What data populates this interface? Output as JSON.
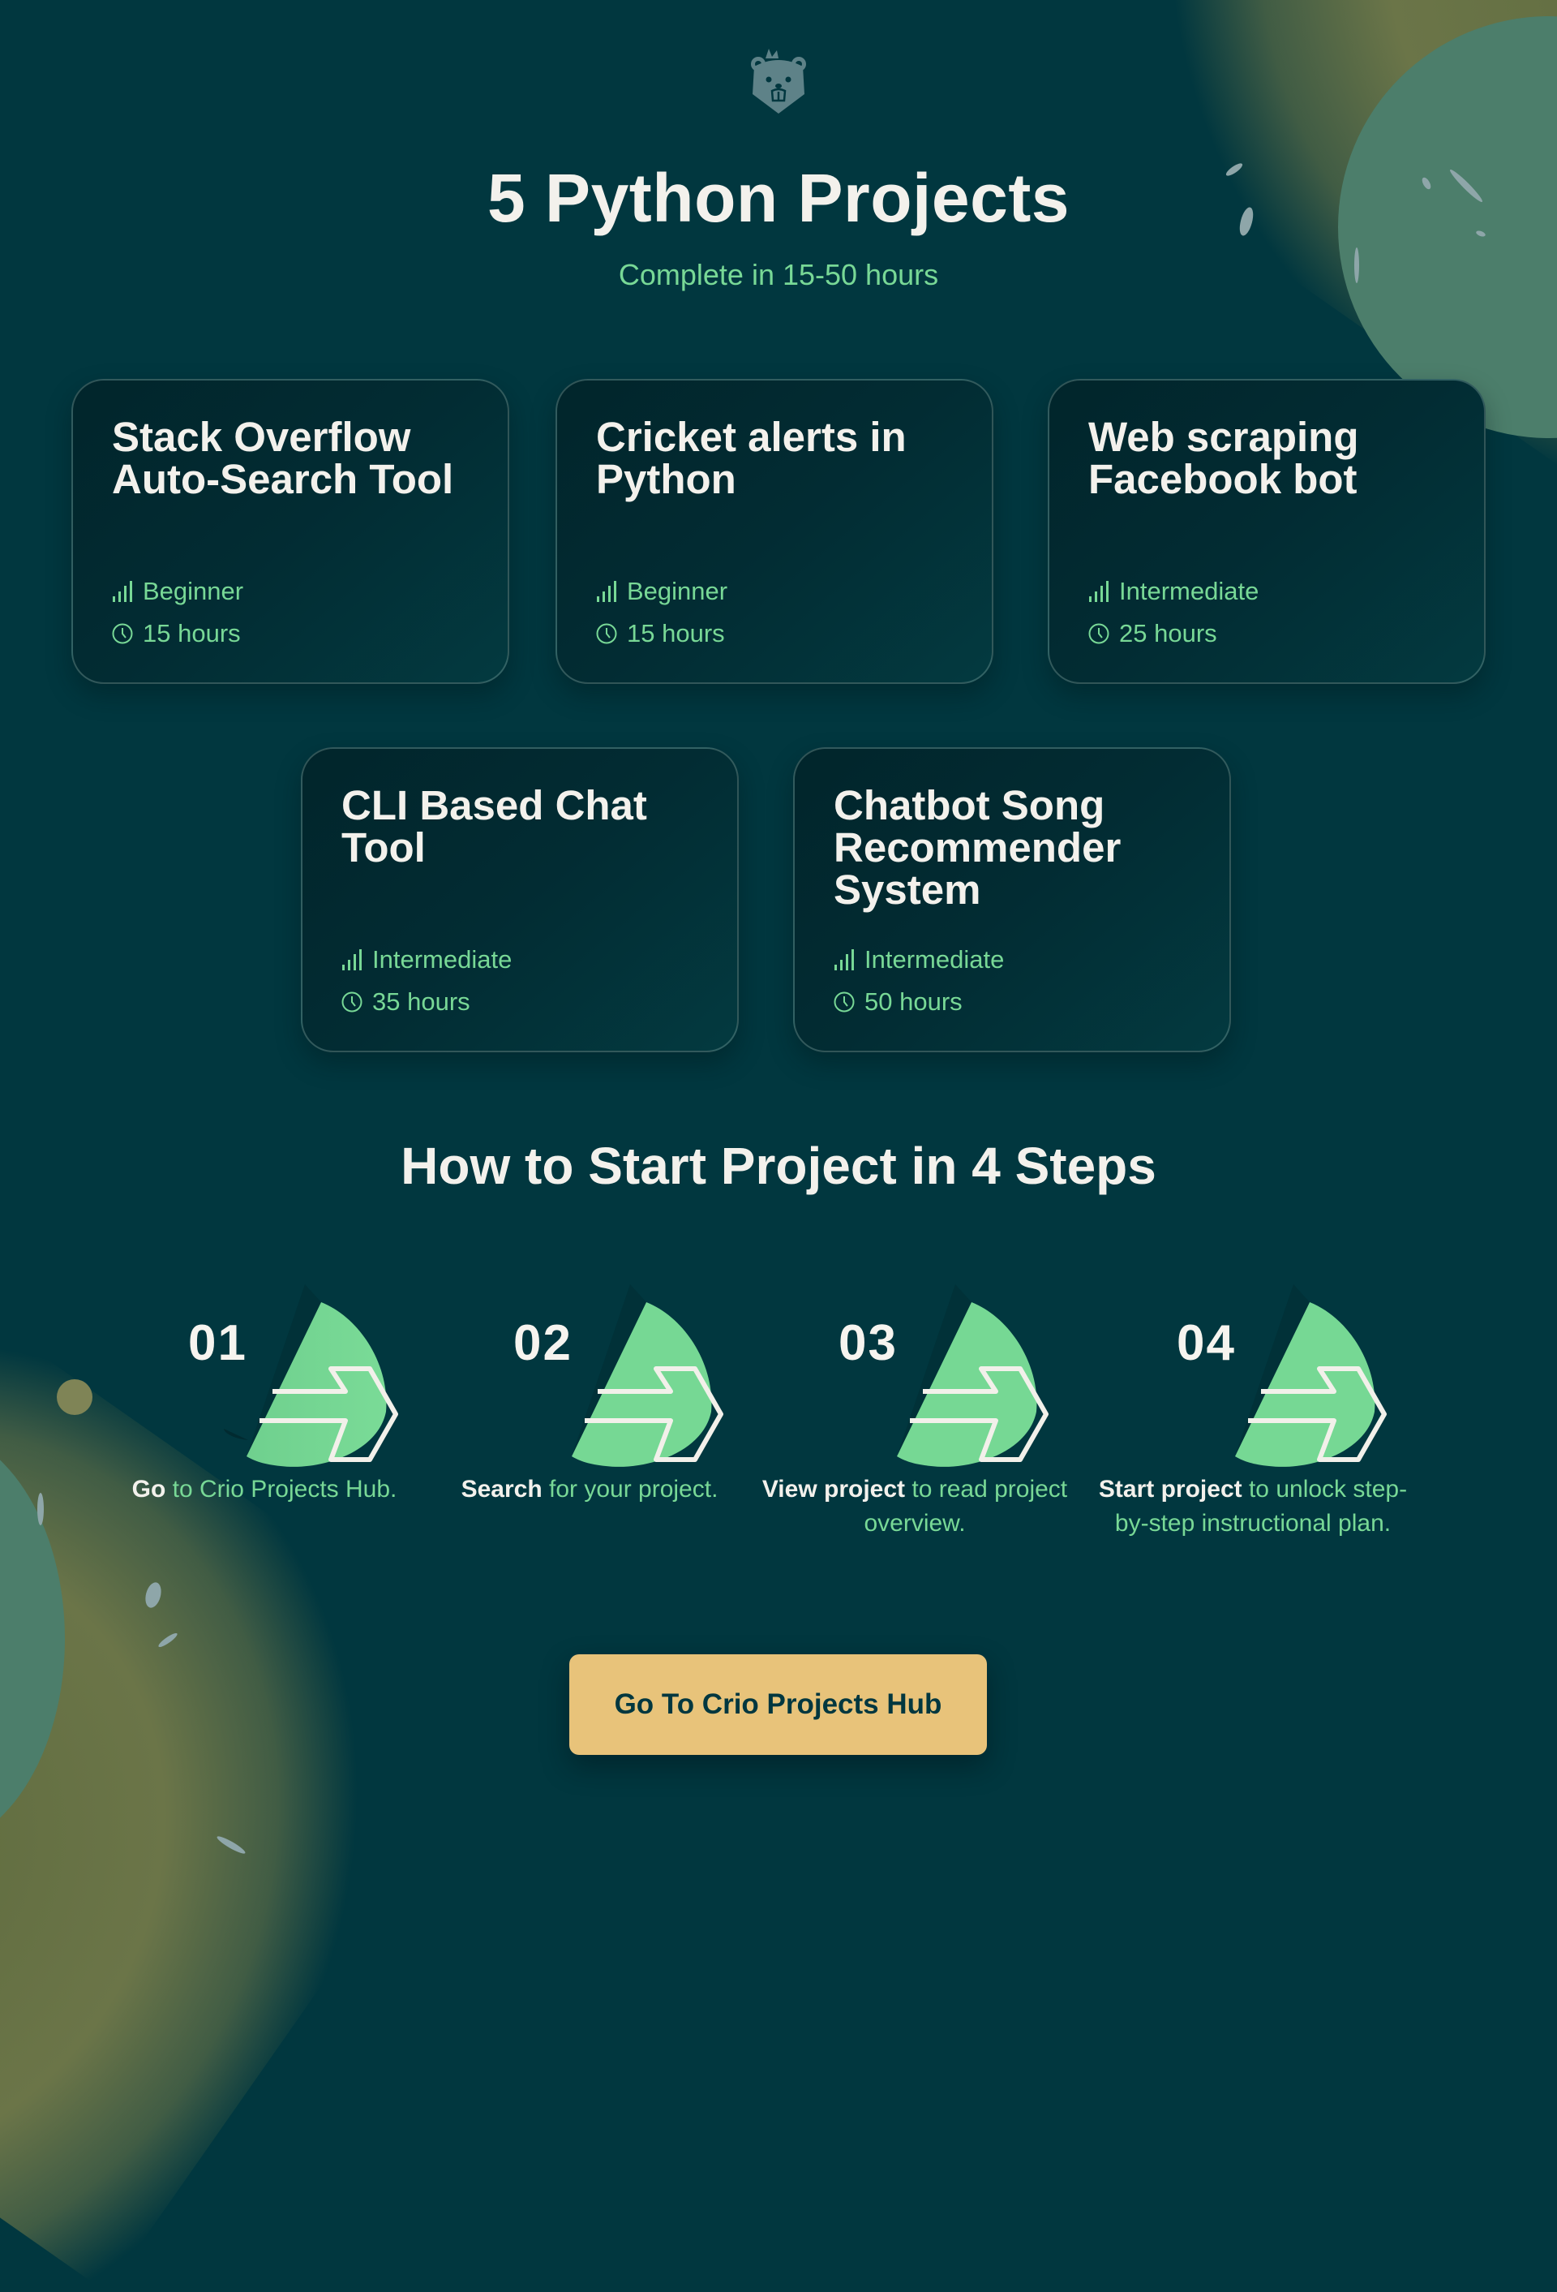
{
  "header": {
    "logo_icon": "beaver-mascot-icon",
    "title": "5 Python Projects",
    "subtitle": "Complete in 15-50 hours"
  },
  "projects": [
    {
      "title": "Stack Overflow Auto-Search Tool",
      "level": "Beginner",
      "duration": "15 hours"
    },
    {
      "title": "Cricket alerts in Python",
      "level": "Beginner",
      "duration": "15 hours"
    },
    {
      "title": "Web scraping Facebook bot",
      "level": "Intermediate",
      "duration": "25 hours"
    },
    {
      "title": "CLI Based Chat Tool",
      "level": "Intermediate",
      "duration": "35 hours"
    },
    {
      "title": "Chatbot Song Recommender System",
      "level": "Intermediate",
      "duration": "50 hours"
    }
  ],
  "project_meta_icons": {
    "level": "signal-bars-icon",
    "duration": "clock-icon"
  },
  "steps_section": {
    "title": "How to Start Project in 4 Steps",
    "step_icon": "arrow-leaf-icon",
    "steps": [
      {
        "number": "01",
        "bold": "Go",
        "rest": " to Crio Projects Hub."
      },
      {
        "number": "02",
        "bold": "Search",
        "rest": " for your project."
      },
      {
        "number": "03",
        "bold": "View project",
        "rest": " to read project overview."
      },
      {
        "number": "04",
        "bold": "Start project",
        "rest": " to unlock step-by-step instructional plan."
      }
    ]
  },
  "cta": {
    "label": "Go To Crio Projects Hub"
  },
  "colors": {
    "background": "#01373f",
    "accent_green": "#78d896",
    "cta_yellow": "#e8c37a",
    "text_light": "#f3f1ec",
    "decor_teal": "#4c7e6b",
    "decor_olive": "#6b7548"
  }
}
